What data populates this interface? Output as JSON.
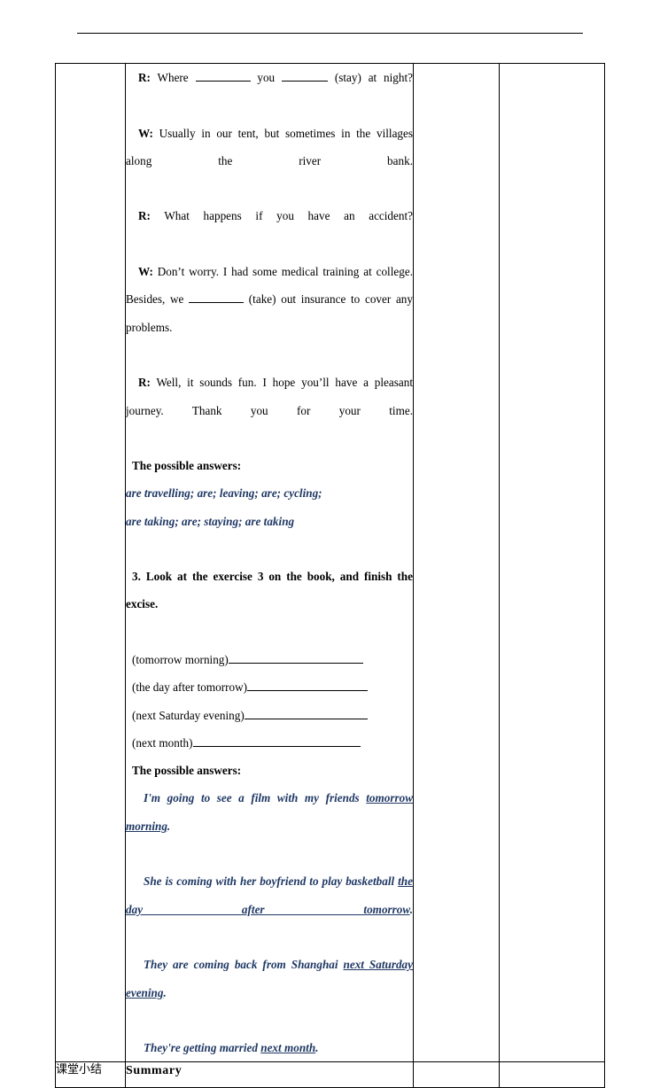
{
  "document": {
    "type": "lesson-plan-worksheet",
    "header_rule": true,
    "table": {
      "columns": [
        "label",
        "content",
        "column-3",
        "column-4"
      ],
      "rows": [
        {
          "label": "",
          "content_blocks": [
            {
              "kind": "dialogue",
              "speaker": "R:",
              "text_before": " Where ",
              "blank1": true,
              "text_mid": " you ",
              "blank2": true,
              "text_after": " (stay) at night?"
            },
            {
              "kind": "plain",
              "text": "W: Usually in our tent, but sometimes in the villages along the river bank."
            },
            {
              "kind": "plain",
              "text": "R: What happens if you have an accident?"
            },
            {
              "kind": "plain2",
              "text_a": "W: Don’t worry. I had some medical training at college. Besides, we ",
              "blank": true,
              "text_b": " (take) out insurance to cover any problems."
            },
            {
              "kind": "plain",
              "text": "R: Well, it sounds fun. I hope you’ll have a pleasant journey. Thank you for your time."
            },
            {
              "kind": "heading",
              "text": "The possible answers:"
            },
            {
              "kind": "answer",
              "text": "are travelling;    are; leaving;    are;    cycling;"
            },
            {
              "kind": "answer",
              "text": "are taking;    are;    staying;    are taking"
            },
            {
              "kind": "heading2",
              "text": "3. Look at the exercise 3 on the book, and finish the excise."
            },
            {
              "kind": "fill",
              "prompt": "(tomorrow morning)"
            },
            {
              "kind": "fill",
              "prompt": "(the day after tomorrow)"
            },
            {
              "kind": "fill",
              "prompt": "(next Saturday evening)"
            },
            {
              "kind": "fill",
              "prompt": "(next month)"
            },
            {
              "kind": "heading",
              "text": "The possible answers:"
            },
            {
              "kind": "answer_u",
              "pre": "I'm going to see a film with my friends ",
              "underline": "tomorrow morning",
              "post": "."
            },
            {
              "kind": "answer_u",
              "pre": "She is coming with her boyfriend to play basketball ",
              "underline": "the day after tomorrow",
              "post": "."
            },
            {
              "kind": "answer_u",
              "pre": "They are coming back from Shanghai ",
              "underline": "next Saturday evening",
              "post": "."
            },
            {
              "kind": "answer_u",
              "pre": "They're getting married ",
              "underline": "next month",
              "post": "."
            }
          ],
          "col3": "",
          "col4": ""
        },
        {
          "label": "课堂小结",
          "summary": "Summary",
          "col3": "",
          "col4": ""
        }
      ]
    },
    "lines": {
      "l1_speaker": "R:",
      "l1_a": " Where ",
      "l1_b": " you ",
      "l1_c": " (stay) at night?",
      "l2_speaker": "W:",
      "l2_text": " Usually in our tent, but sometimes in the villages along the river bank.",
      "l3_speaker": "R:",
      "l3_text": " What happens if you have an accident?",
      "l4_speaker": "W:",
      "l4_a": " Don’t worry. I had some medical training at college. Besides, we ",
      "l4_b": " (take) out insurance to cover any problems.",
      "l5_speaker": "R:",
      "l5_text": " Well, it sounds fun. I hope you’ll have a pleasant journey. Thank you for your time.",
      "answers_heading_1": "The possible answers:",
      "answers_1a": "are travelling;    are; leaving;    are;    cycling;",
      "answers_1b": "are taking;    are;    staying;    are taking",
      "task3_heading": "3. Look at the exercise 3 on the book, and finish the excise.",
      "fill_1": "(tomorrow morning)",
      "fill_2": "(the day after tomorrow)",
      "fill_3": "(next Saturday evening)",
      "fill_4": "(next month)",
      "answers_heading_2": "The possible answers:",
      "answer_2a_pre": "I'm going to see a film with my friends ",
      "answer_2a_u": "tomorrow morning",
      "answer_2a_post": ".",
      "answer_2b_pre": "She is coming with her boyfriend to play basketball ",
      "answer_2b_u": "the day after tomorrow",
      "answer_2b_post": ".",
      "answer_2c_pre": "They are coming back from Shanghai ",
      "answer_2c_u": "next Saturday evening",
      "answer_2c_post": ".",
      "answer_2d_pre": "They're getting married ",
      "answer_2d_u": "next month",
      "answer_2d_post": "."
    },
    "summary_row": {
      "label": "课堂小结",
      "title": "Summary"
    },
    "colors": {
      "answer_blue": "#1f3864",
      "text_black": "#000000",
      "border": "#000000"
    }
  }
}
